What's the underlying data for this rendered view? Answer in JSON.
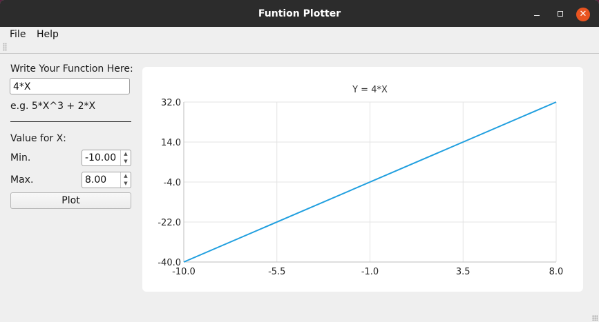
{
  "window": {
    "title": "Funtion Plotter",
    "minimize_glyph": "",
    "maximize_glyph": "",
    "close_glyph": "✕"
  },
  "menu": {
    "file": "File",
    "help": "Help"
  },
  "form": {
    "prompt_label": "Write Your Function Here:",
    "function_value": "4*X",
    "example_text": "e.g. 5*X^3  + 2*X",
    "x_section_label": "Value for X:",
    "min_label": "Min.",
    "min_value": "-10.00",
    "max_label": "Max.",
    "max_value": "8.00",
    "plot_button": "Plot"
  },
  "icons": {
    "spin_up": "▲",
    "spin_down": "▼"
  },
  "colors": {
    "titlebar": "#2c2c2c",
    "close_button": "#e95420",
    "series_line": "#209fdf",
    "grid": "#e3e3e3"
  },
  "chart_data": {
    "type": "line",
    "title": "Y = 4*X",
    "x_ticks": [
      "-10.0",
      "-5.5",
      "-1.0",
      "3.5",
      "8.0"
    ],
    "y_ticks": [
      "32.0",
      "14.0",
      "-4.0",
      "-22.0",
      "-40.0"
    ],
    "xlim": [
      -10,
      8
    ],
    "ylim": [
      -40,
      32
    ],
    "grid": true,
    "series": [
      {
        "x": [
          -10,
          8
        ],
        "y": [
          -40,
          32
        ]
      }
    ]
  }
}
